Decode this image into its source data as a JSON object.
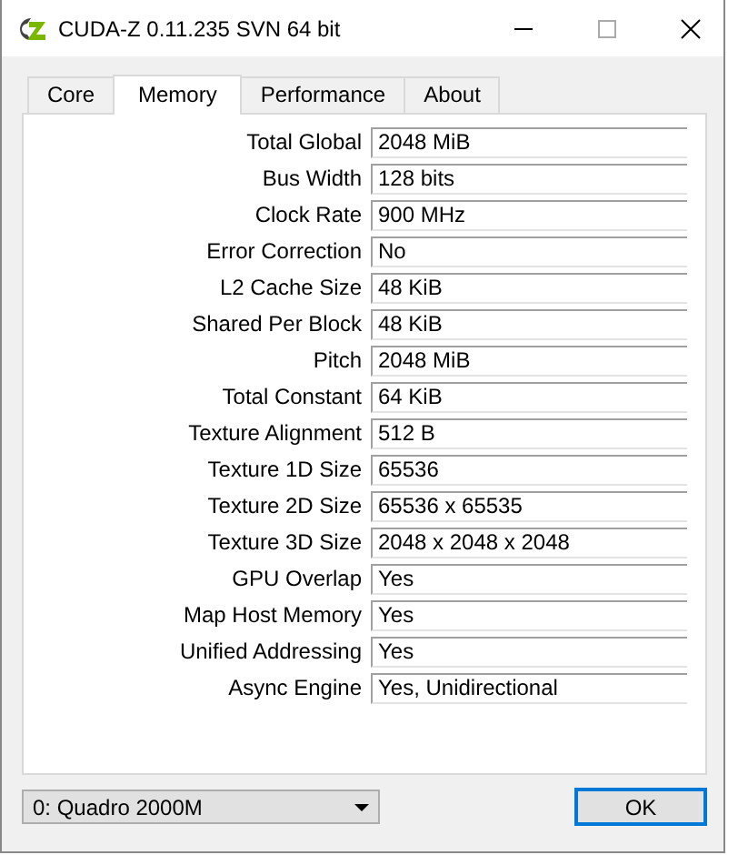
{
  "window": {
    "title": "CUDA-Z 0.11.235 SVN 64 bit"
  },
  "tabs": [
    {
      "label": "Core",
      "selected": false
    },
    {
      "label": "Memory",
      "selected": true
    },
    {
      "label": "Performance",
      "selected": false
    },
    {
      "label": "About",
      "selected": false
    }
  ],
  "fields": [
    {
      "label": "Total Global",
      "value": "2048 MiB"
    },
    {
      "label": "Bus Width",
      "value": "128 bits"
    },
    {
      "label": "Clock Rate",
      "value": "900 MHz"
    },
    {
      "label": "Error Correction",
      "value": "No"
    },
    {
      "label": "L2 Cache Size",
      "value": "48 KiB"
    },
    {
      "label": "Shared Per Block",
      "value": "48 KiB"
    },
    {
      "label": "Pitch",
      "value": "2048 MiB"
    },
    {
      "label": "Total Constant",
      "value": "64 KiB"
    },
    {
      "label": "Texture Alignment",
      "value": "512 B"
    },
    {
      "label": "Texture 1D Size",
      "value": "65536"
    },
    {
      "label": "Texture 2D Size",
      "value": "65536 x 65535"
    },
    {
      "label": "Texture 3D Size",
      "value": "2048 x 2048 x 2048"
    },
    {
      "label": "GPU Overlap",
      "value": "Yes"
    },
    {
      "label": "Map Host Memory",
      "value": "Yes"
    },
    {
      "label": "Unified Addressing",
      "value": "Yes"
    },
    {
      "label": "Async Engine",
      "value": "Yes, Unidirectional"
    }
  ],
  "device_select": {
    "value": "0: Quadro 2000M"
  },
  "buttons": [
    {
      "label": "OK"
    }
  ]
}
